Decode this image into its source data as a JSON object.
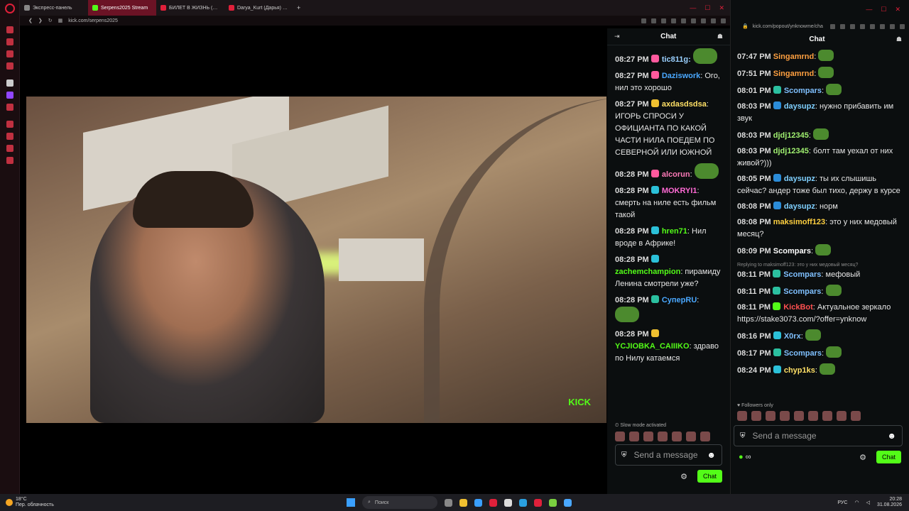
{
  "browser": {
    "tabs": [
      {
        "label": "Экспресс-панель",
        "active": false,
        "color": "#888888"
      },
      {
        "label": "Serpens2025 Stream",
        "active": true,
        "color": "#53fc18"
      },
      {
        "label": "БИЛЕТ В ЖИЗНЬ (53-я с",
        "active": false,
        "color": "#e0203a"
      },
      {
        "label": "Darya_Kurt (Дарья) | Про",
        "active": false,
        "color": "#e0203a"
      }
    ],
    "new_tab": "+",
    "url": "kick.com/serpens2025"
  },
  "stream": {
    "watermark": "KICK"
  },
  "chat_left": {
    "title": "Chat",
    "messages": [
      {
        "ts": "08:27 PM",
        "user": "tic811g:",
        "user_color": "#9ad0ff",
        "badge_color": "#ff5a9e",
        "text": "",
        "emote": true
      },
      {
        "ts": "08:27 PM",
        "user": "Daziswork",
        "user_color": "#4aa8ff",
        "badge_color": "#ff5a9e",
        "text": ": Ого, нил это хорошо",
        "emote": false
      },
      {
        "ts": "08:27 PM",
        "user": "axdasdsdsa",
        "user_color": "#ffe066",
        "badge_color": "#f0c030",
        "text": ": ИГОРЬ СПРОСИ У ОФИЦИАНТА ПО КАКОЙ ЧАСТИ НИЛА ПОЕДЕМ ПО СЕВЕРНОЙ ИЛИ ЮЖНОЙ",
        "emote": false
      },
      {
        "ts": "08:28 PM",
        "user": "alcorun",
        "user_color": "#ff7ab8",
        "badge_color": "#ff5a9e",
        "text": ":",
        "emote": true
      },
      {
        "ts": "08:28 PM",
        "user": "MOKRYI1",
        "user_color": "#ff6ad5",
        "badge_color": "#2bc0d8",
        "text": ": смерть на ниле есть фильм такой",
        "emote": false
      },
      {
        "ts": "08:28 PM",
        "user": "hren71",
        "user_color": "#53fc18",
        "badge_color": "#2bc0d8",
        "text": ": Нил вроде в Африке!",
        "emote": false
      },
      {
        "ts": "08:28 PM",
        "user": "zachemchampion",
        "user_color": "#53fc18",
        "badge_color": "#2bc0d8",
        "text": ": пирамиду Ленина смотрели уже?",
        "emote": false
      },
      {
        "ts": "08:28 PM",
        "user": "СупeрRU",
        "user_color": "#4aa8ff",
        "badge_color": "#2bc0a0",
        "text": ":",
        "emote": true
      },
      {
        "ts": "08:28 PM",
        "user": "YCJIOBKA_CAIIIKO",
        "user_color": "#53fc18",
        "badge_color": "#f0c030",
        "text": ": здраво по Нилу катаемся",
        "emote": false
      }
    ],
    "slow_mode": "Slow mode activated",
    "input_placeholder": "Send a message",
    "chat_button": "Chat"
  },
  "chat_right": {
    "title": "Chat",
    "url": "kick.com/popout/ynknowme/cha",
    "messages": [
      {
        "reply": "",
        "ts": "07:47 PM",
        "user": "Singamrnd",
        "user_color": "#ffa040",
        "badge_color": "",
        "text": ":",
        "emote": true
      },
      {
        "reply": "",
        "ts": "07:51 PM",
        "user": "Singamrnd",
        "user_color": "#ffa040",
        "badge_color": "",
        "text": ":",
        "emote": true
      },
      {
        "reply": "",
        "ts": "08:01 PM",
        "user": "Scompars",
        "user_color": "#7fc0ff",
        "badge_color": "#2bc0a0",
        "text": ":",
        "emote": true
      },
      {
        "reply": "",
        "ts": "08:03 PM",
        "user": "daysupz",
        "user_color": "#7fd0ff",
        "badge_color": "#2b8cd8",
        "text": ": нужно прибавить им звук",
        "emote": false
      },
      {
        "reply": "",
        "ts": "08:03 PM",
        "user": "djdj12345",
        "user_color": "#a0f070",
        "badge_color": "",
        "text": ":",
        "emote": true
      },
      {
        "reply": "",
        "ts": "08:03 PM",
        "user": "djdj12345",
        "user_color": "#a0f070",
        "badge_color": "",
        "text": ": болт там уехал от них живой?)))",
        "emote": false
      },
      {
        "reply": "",
        "ts": "08:05 PM",
        "user": "daysupz",
        "user_color": "#7fd0ff",
        "badge_color": "#2b8cd8",
        "text": ": ты их слышишь сейчас? андер тоже был тихо, держу в курсе",
        "emote": false
      },
      {
        "reply": "",
        "ts": "08:08 PM",
        "user": "daysupz",
        "user_color": "#7fd0ff",
        "badge_color": "#2b8cd8",
        "text": ": норм",
        "emote": false
      },
      {
        "reply": "",
        "ts": "08:08 PM",
        "user": "maksimoff123",
        "user_color": "#ffd040",
        "badge_color": "",
        "text": ": это у них медовый месяц?",
        "emote": false
      },
      {
        "reply": "",
        "ts": "08:09 PM",
        "user": "Scompars",
        "user_color": "#ffffff",
        "badge_color": "",
        "text": ":",
        "emote": true
      },
      {
        "reply": "Replying to maksimoff123: это у них медовый месяц?",
        "ts": "08:11 PM",
        "user": "Scompars",
        "user_color": "#7fc0ff",
        "badge_color": "#2bc0a0",
        "text": ": мефовый",
        "emote": false
      },
      {
        "reply": "",
        "ts": "08:11 PM",
        "user": "Scompars",
        "user_color": "#7fc0ff",
        "badge_color": "#2bc0a0",
        "text": ":",
        "emote": true
      },
      {
        "reply": "",
        "ts": "08:11 PM",
        "user": "KickBot",
        "user_color": "#ff5050",
        "badge_color": "#53fc18",
        "text": ": Актуальное зеркало https://stake3073.com/?offer=ynknow",
        "emote": false
      },
      {
        "reply": "",
        "ts": "08:16 PM",
        "user": "X0rx",
        "user_color": "#7fc0ff",
        "badge_color": "#2bc0d8",
        "text": ":",
        "emote": true
      },
      {
        "reply": "",
        "ts": "08:17 PM",
        "user": "Scompars",
        "user_color": "#7fc0ff",
        "badge_color": "#2bc0a0",
        "text": ":",
        "emote": true
      },
      {
        "reply": "",
        "ts": "08:24 PM",
        "user": "chyp1ks",
        "user_color": "#ffe066",
        "badge_color": "#2bc0d8",
        "text": ":",
        "emote": true
      }
    ],
    "followers_only": "Followers only",
    "input_placeholder": "Send a message",
    "infinity": "∞",
    "chat_button": "Chat"
  },
  "taskbar": {
    "temp": "18°C",
    "weather": "Пер. облачность",
    "search": "Поиск",
    "lang": "РУС",
    "time": "20:28",
    "date": "31.08.2026"
  }
}
